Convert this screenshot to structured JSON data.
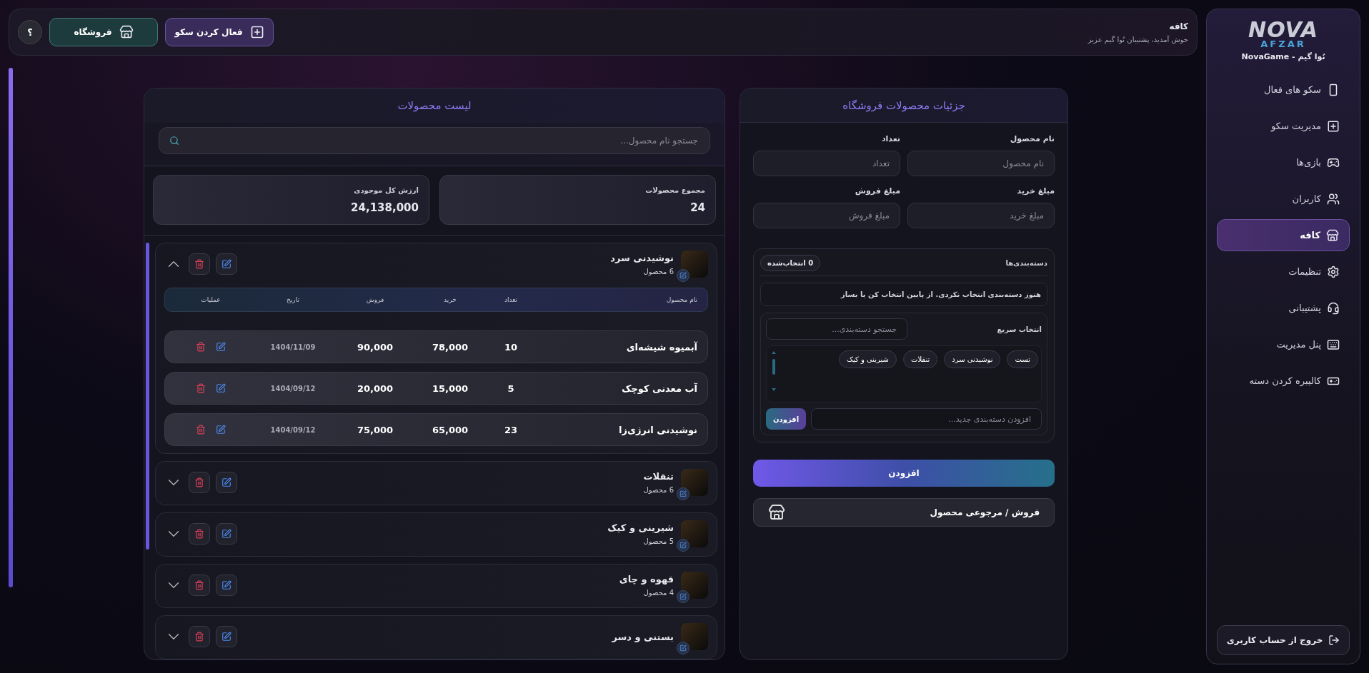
{
  "sidebar": {
    "logo": {
      "text": "NOVA",
      "subtext": "AFZAR"
    },
    "brand": "نُوا گیم - NovaGame",
    "items": [
      {
        "label": "سکو های فعال",
        "selected": false
      },
      {
        "label": "مدیریت سکو",
        "selected": false
      },
      {
        "label": "بازی‌ها",
        "selected": false
      },
      {
        "label": "کاربران",
        "selected": false
      },
      {
        "label": "کافه",
        "selected": true
      },
      {
        "label": "تنظیمات",
        "selected": false
      },
      {
        "label": "پشتیبانی",
        "selected": false
      },
      {
        "label": "پنل مدیریت",
        "selected": false
      },
      {
        "label": "کالیبره کردن دسته",
        "selected": false
      }
    ],
    "logout": "خروج از حساب کاربری"
  },
  "header": {
    "title": "کافه",
    "subtitle": "خوش آمدید، پشتیبان نُوا گیم عزیز",
    "buttons": [
      {
        "label": "فعال کردن سکو",
        "kind": "console"
      },
      {
        "label": "فروشگاه",
        "kind": "store"
      }
    ],
    "help": "؟"
  },
  "details": {
    "title": "جزئیات محصولات فروشگاه",
    "fields": [
      {
        "label": "نام محصول",
        "placeholder": "نام محصول"
      },
      {
        "label": "تعداد",
        "placeholder": "تعداد"
      },
      {
        "label": "مبلغ خرید",
        "placeholder": "مبلغ خرید"
      },
      {
        "label": "مبلغ فروش",
        "placeholder": "مبلغ فروش"
      }
    ],
    "categories": {
      "title": "دسته‌بندی‌ها",
      "selected_count": "0 انتخاب‌شده",
      "empty_message": "هنوز دسته‌بندی انتخاب نکردی. از پایین انتخاب کن یا بساز",
      "quick_label": "انتخاب سریع",
      "search_placeholder": "جستجو دسته‌بندی...",
      "chips": [
        {
          "label": "تست",
          "selected": false
        },
        {
          "label": "نوشیدنی سرد",
          "selected": false
        },
        {
          "label": "تنقلات",
          "selected": false
        },
        {
          "label": "شیرینی و کیک",
          "selected": false
        }
      ],
      "new_placeholder": "افزودن دسته‌بندی جدید...",
      "add_button": "افزودن"
    },
    "submit": "افزودن",
    "sale_button": "فروش / مرجوعی محصول"
  },
  "list": {
    "title": "لیست محصولات",
    "search_placeholder": "جستجو نام محصول...",
    "stats": [
      {
        "label": "مجموع محصولات",
        "value": "24"
      },
      {
        "label": "ارزش کل موجودی",
        "value": "24,138,000"
      }
    ],
    "columns": [
      "نام محصول",
      "تعداد",
      "خرید",
      "فروش",
      "تاریخ",
      "عملیات"
    ],
    "categories": [
      {
        "name": "نوشیدنی سرد",
        "count": "6 محصول",
        "expanded": true,
        "products": [
          {
            "name": "آبمیوه شیشه‌ای",
            "qty": "10",
            "buy": "78,000",
            "sell": "90,000",
            "date": "1404/11/09"
          },
          {
            "name": "آب معدنی کوچک",
            "qty": "5",
            "buy": "15,000",
            "sell": "20,000",
            "date": "1404/09/12"
          },
          {
            "name": "نوشیدنی انرژی‌زا",
            "qty": "23",
            "buy": "65,000",
            "sell": "75,000",
            "date": "1404/09/12"
          }
        ]
      },
      {
        "name": "تنقلات",
        "count": "6 محصول",
        "expanded": false
      },
      {
        "name": "شیرینی و کیک",
        "count": "5 محصول",
        "expanded": false
      },
      {
        "name": "قهوه و چای",
        "count": "4 محصول",
        "expanded": false
      },
      {
        "name": "بستنی و دسر",
        "expanded": false
      }
    ]
  }
}
